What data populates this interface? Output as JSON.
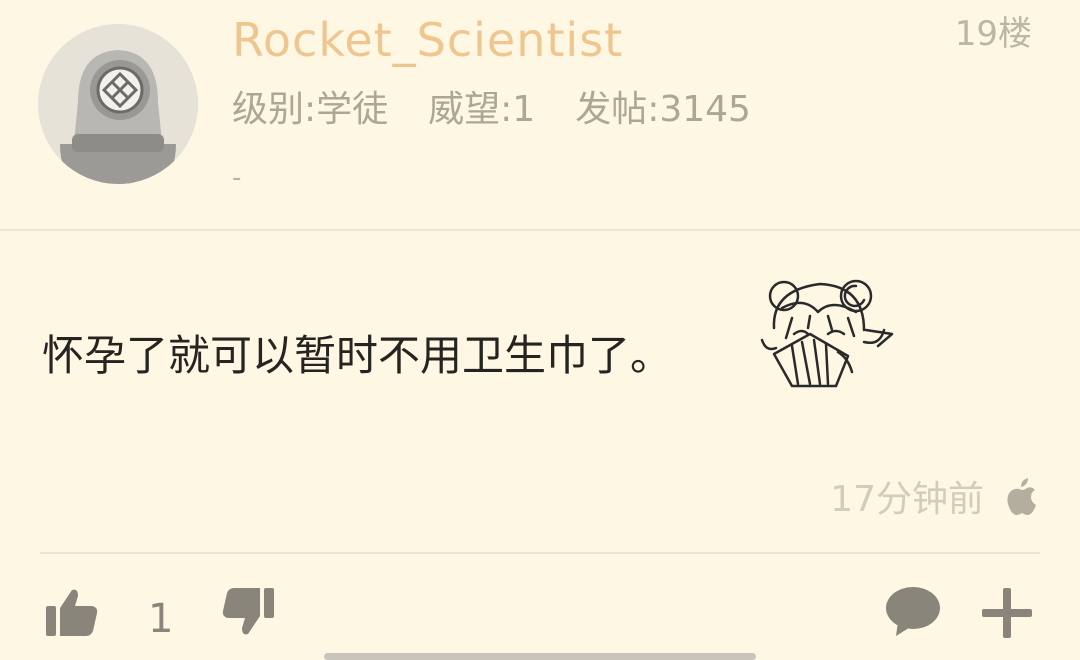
{
  "post": {
    "username": "Rocket_Scientist",
    "floor": "19楼",
    "stats": {
      "level": "级别:学徒",
      "prestige": "威望:1",
      "posts": "发帖:3145"
    },
    "signature": "-",
    "content": "怀孕了就可以暂时不用卫生巾了。",
    "time": "17分钟前",
    "likes": "1"
  },
  "icons": {
    "avatar": "diver-helmet-avatar",
    "sticker": "anime-girl-sticker",
    "device": "apple-icon",
    "like": "thumb-up-icon",
    "dislike": "thumb-down-icon",
    "comment": "comment-icon",
    "more": "plus-icon"
  },
  "colors": {
    "background": "#fdf7e4",
    "username": "#f0c690",
    "text": "#262420",
    "muted": "#aca692",
    "icon": "#8a857a"
  }
}
